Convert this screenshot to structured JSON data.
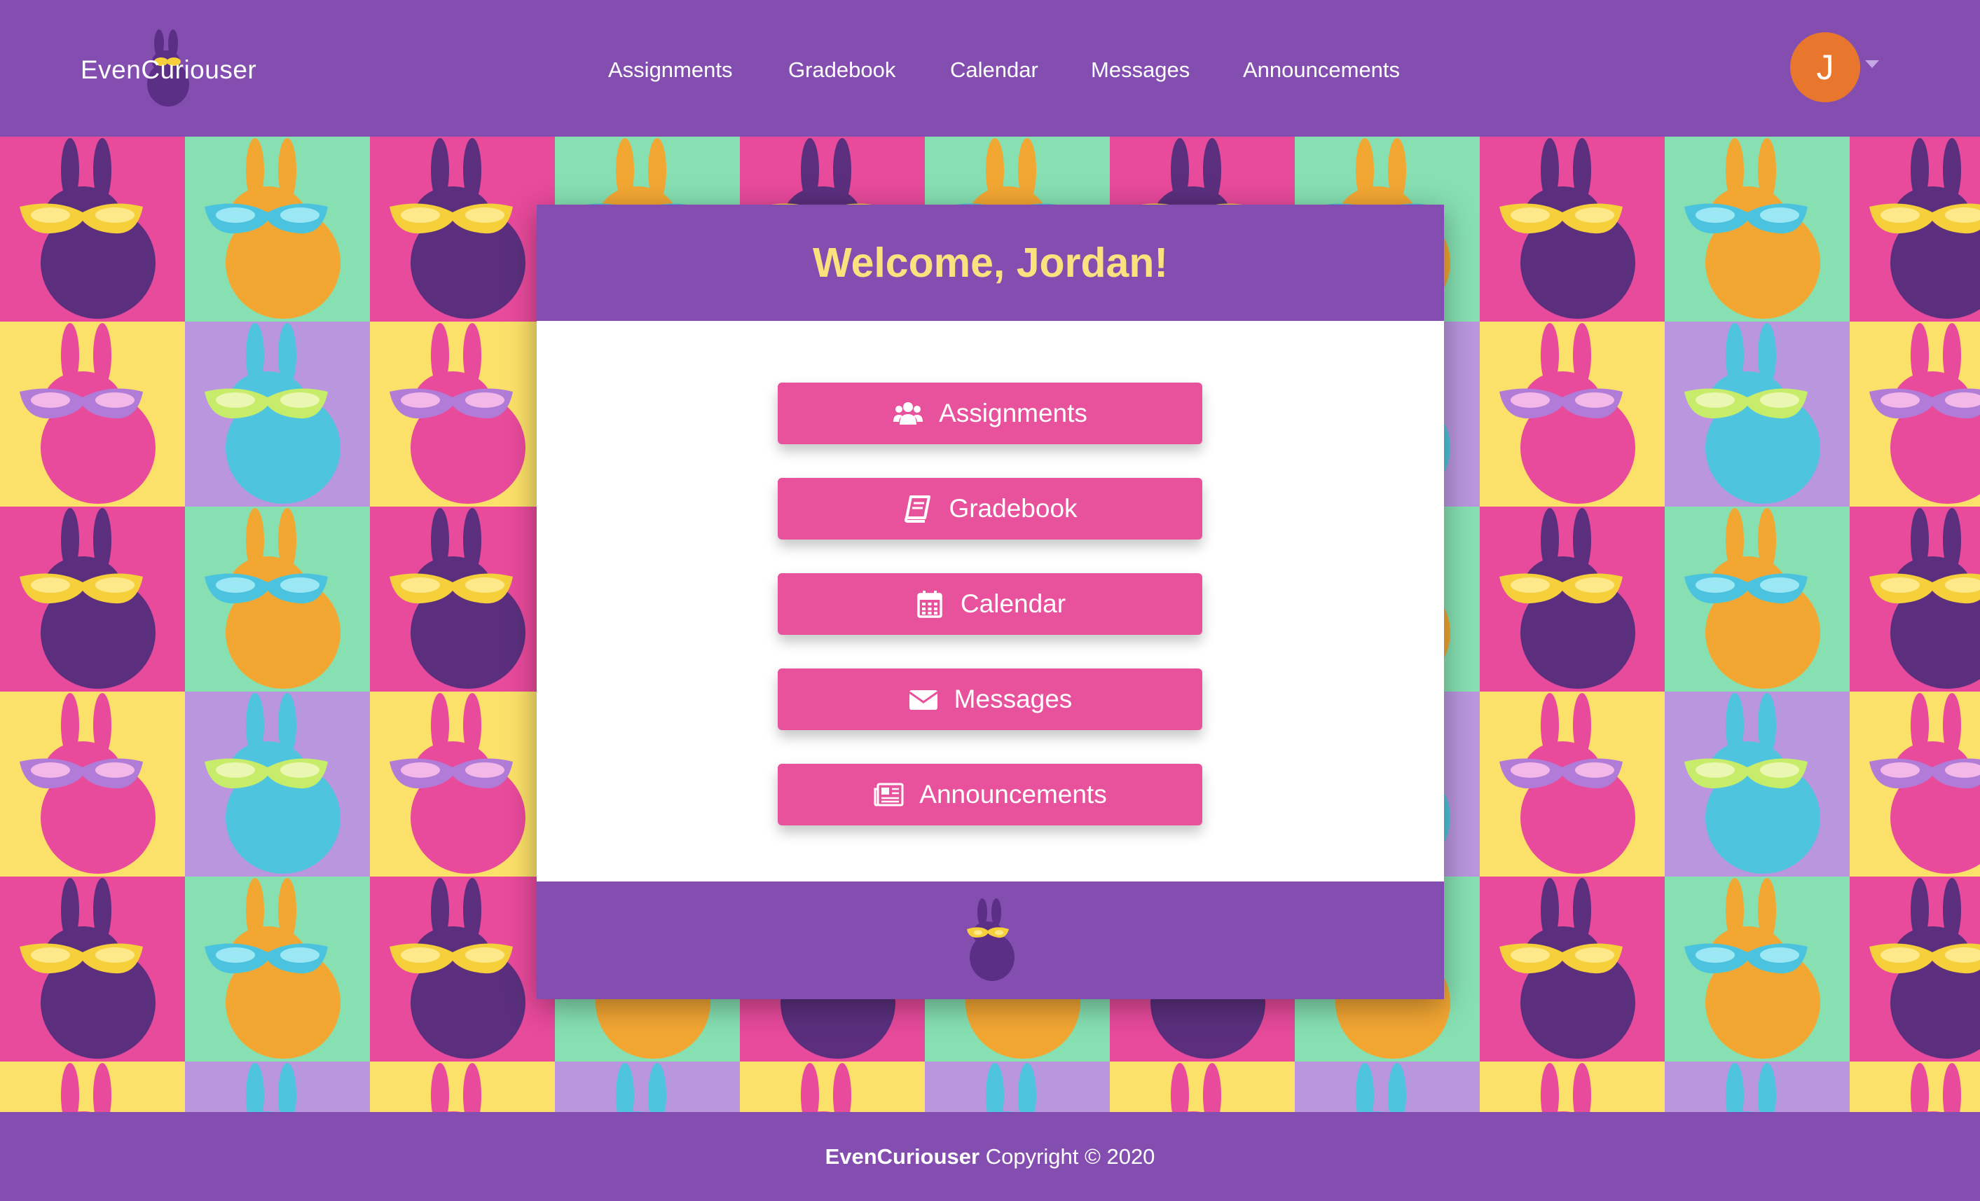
{
  "brand": {
    "name": "EvenCuriouser"
  },
  "nav": {
    "links": [
      "Assignments",
      "Gradebook",
      "Calendar",
      "Messages",
      "Announcements"
    ]
  },
  "user": {
    "initial": "J"
  },
  "card": {
    "title": "Welcome, Jordan!",
    "buttons": [
      {
        "label": "Assignments",
        "icon": "users-icon"
      },
      {
        "label": "Gradebook",
        "icon": "book-icon"
      },
      {
        "label": "Calendar",
        "icon": "calendar-icon"
      },
      {
        "label": "Messages",
        "icon": "envelope-icon"
      },
      {
        "label": "Announcements",
        "icon": "newspaper-icon"
      }
    ]
  },
  "footer": {
    "brand": "EvenCuriouser",
    "copyright": "Copyright © 2020"
  },
  "colors": {
    "primary_purple": "#844eb0",
    "accent_pink": "#e8529c",
    "title_yellow": "#fbe27f",
    "avatar_orange": "#e8762c"
  }
}
